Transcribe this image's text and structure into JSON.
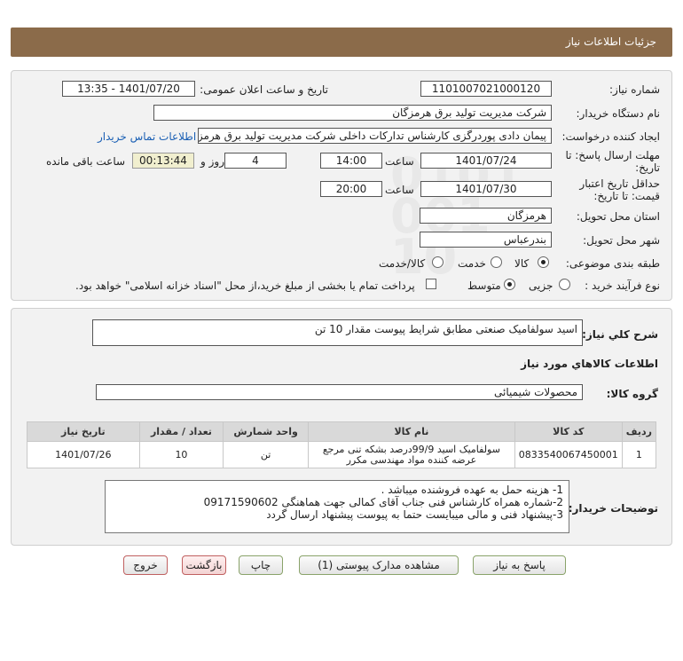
{
  "header": {
    "title": "جزئیات اطلاعات نیاز"
  },
  "info": {
    "need_number_label": "شماره نیاز:",
    "need_number": "1101007021000120",
    "announce_label": "تاریخ و ساعت اعلان عمومی:",
    "announce_value": "1401/07/20 - 13:35",
    "buyer_label": "نام دستگاه خریدار:",
    "buyer_value": "شرکت مدیریت تولید برق هرمزگان",
    "creator_label": "ایجاد کننده درخواست:",
    "creator_value": "پیمان دادی پوردرگزی کارشناس تدارکات داخلی شرکت مدیریت تولید برق هرمزگان",
    "contact_link": "اطلاعات تماس خریدار",
    "deadline_label_1": "مهلت ارسال پاسخ: تا",
    "deadline_label_2": "تاریخ:",
    "deadline_date": "1401/07/24",
    "time_label": "ساعت",
    "deadline_time": "14:00",
    "days_value": "4",
    "days_label": "روز و",
    "remaining_value": "00:13:44",
    "remaining_label": "ساعت باقی مانده",
    "validity_label_1": "حداقل تاریخ اعتبار",
    "validity_label_2": "قیمت: تا تاریخ:",
    "validity_date": "1401/07/30",
    "validity_time": "20:00",
    "province_label": "استان محل تحویل:",
    "province_value": "هرمزگان",
    "city_label": "شهر محل تحویل:",
    "city_value": "بندرعباس",
    "category_label": "طبقه بندی موضوعی:",
    "category_options": [
      "کالا",
      "خدمت",
      "کالا/خدمت"
    ],
    "category_selected": 0,
    "process_label": "نوع فرآیند خرید :",
    "process_options": [
      "جزیی",
      "متوسط"
    ],
    "process_selected": 1,
    "payment_note": "پرداخت تمام یا بخشی از مبلغ خرید،از محل \"اسناد خزانه اسلامی\" خواهد بود."
  },
  "description": {
    "label": "شرح کلي نياز:",
    "value": "اسید سولفامیک صنعتی مطابق شرایط پیوست مقدار 10 تن"
  },
  "goods": {
    "section_title": "اطلاعات کالاهاي مورد نياز",
    "group_label": "گروه کالا:",
    "group_value": "محصولات شیمیائی",
    "columns": [
      "ردیف",
      "کد کالا",
      "نام کالا",
      "واحد شمارش",
      "تعداد / مقدار",
      "تاریخ نیاز"
    ],
    "rows": [
      {
        "index": "1",
        "code": "0833540067450001",
        "name": "سولفامیک اسید 99/9درصد بشکه تنی مرجع عرضه کننده مواد مهندسی مکرر",
        "unit": "تن",
        "qty": "10",
        "date": "1401/07/26"
      }
    ]
  },
  "notes": {
    "label": "توضیحات خریدار:",
    "lines": [
      "1- هزینه حمل به عهده فروشنده میباشد .",
      "2-شماره همراه کارشناس فنی جناب آقای کمالی جهت هماهنگی 09171590602",
      "3-پیشنهاد فنی و مالی میبایست حتما به  پیوست  پیشنهاد ارسال گردد"
    ]
  },
  "buttons": {
    "reply": "پاسخ به نیاز",
    "attachments": "مشاهده مدارک پیوستی (1)",
    "print": "چاپ",
    "back": "بازگشت",
    "exit": "خروج"
  },
  "watermark": {
    "brand": "ParsNamadData",
    "line1": "مرکز فراوری اطلاعات پارس نماد داده ها",
    "line2": "پایگاه اطلاع رسانی مناقصات و مزایدات",
    "phone": "۰۲۱-۸۸۳۴۹۶۷۰"
  },
  "colors": {
    "header_bg": "#8b6b4a",
    "link": "#1a5fb4",
    "remaining_bg": "#f1efcf"
  }
}
